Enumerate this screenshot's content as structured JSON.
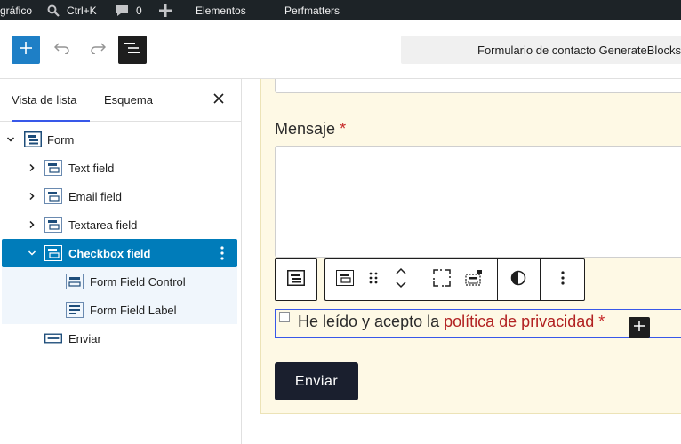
{
  "admin_bar": {
    "site_partial": "gráfico",
    "search_shortcut": "Ctrl+K",
    "comments_count": "0",
    "elementos": "Elementos",
    "perfmatters": "Perfmatters"
  },
  "header": {
    "document_title": "Formulario de contacto GenerateBlocks"
  },
  "sidebar": {
    "tabs": [
      "Vista de lista",
      "Esquema"
    ],
    "tree": [
      {
        "label": "Form"
      },
      {
        "label": "Text field"
      },
      {
        "label": "Email field"
      },
      {
        "label": "Textarea field"
      },
      {
        "label": "Checkbox field"
      },
      {
        "label": "Form Field Control"
      },
      {
        "label": "Form Field Label"
      },
      {
        "label": "Enviar"
      }
    ]
  },
  "canvas": {
    "message_label": "Mensaje",
    "required_mark": "*",
    "checkbox_text": "He leído y acepto la",
    "checkbox_link": "política de privacidad",
    "submit_label": "Enviar"
  },
  "colors": {
    "admin_bar_bg": "#1d2327",
    "accent_blue": "#007cba",
    "form_bg": "#fef9e5",
    "required_red": "#c62828",
    "submit_bg": "#1a1f2e"
  }
}
